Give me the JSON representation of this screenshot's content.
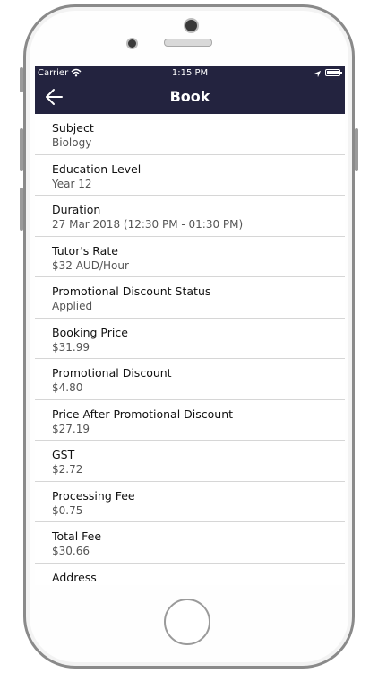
{
  "status_bar": {
    "carrier": "Carrier",
    "time": "1:15 PM"
  },
  "nav": {
    "title": "Book"
  },
  "rows": [
    {
      "label": "Subject",
      "value": "Biology"
    },
    {
      "label": "Education Level",
      "value": "Year 12"
    },
    {
      "label": "Duration",
      "value": "27 Mar 2018 (12:30 PM - 01:30 PM)"
    },
    {
      "label": "Tutor's Rate",
      "value": "$32 AUD/Hour"
    },
    {
      "label": "Promotional Discount Status",
      "value": "Applied"
    },
    {
      "label": "Booking Price",
      "value": "$31.99"
    },
    {
      "label": "Promotional Discount",
      "value": "$4.80"
    },
    {
      "label": "Price After Promotional Discount",
      "value": "$27.19"
    },
    {
      "label": "GST",
      "value": "$2.72"
    },
    {
      "label": "Processing Fee",
      "value": "$0.75"
    },
    {
      "label": "Total Fee",
      "value": "$30.66"
    },
    {
      "label": "Address",
      "value": ""
    }
  ],
  "colors": {
    "header_bg": "#23233f",
    "header_text": "#ffffff"
  },
  "icons": [
    "wifi-icon",
    "location-arrow-icon",
    "battery-icon",
    "back-arrow-icon"
  ]
}
